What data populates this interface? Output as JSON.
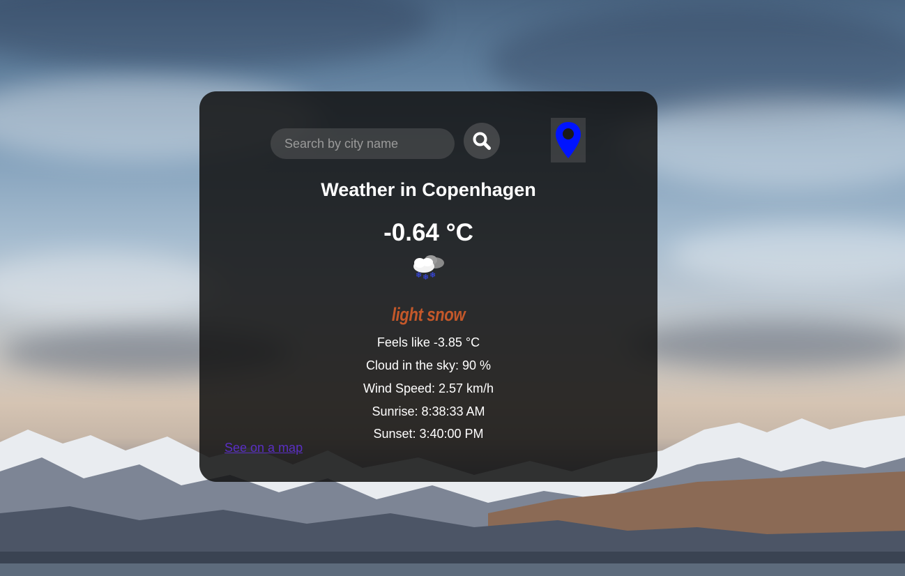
{
  "search": {
    "placeholder": "Search by city name",
    "value": ""
  },
  "icons": {
    "search": "search-icon",
    "location": "location-pin-icon",
    "weather": "snow-cloud-icon"
  },
  "weather": {
    "title": "Weather in Copenhagen",
    "temperature": "-0.64 °C",
    "description": "light snow",
    "feels_like": "Feels like -3.85 °C",
    "clouds": "Cloud in the sky: 90 %",
    "wind": "Wind Speed: 2.57 km/h",
    "sunrise": "Sunrise: 8:38:33 AM",
    "sunset": "Sunset: 3:40:00 PM"
  },
  "links": {
    "map": "See on a map"
  },
  "colors": {
    "card_background": "#121212",
    "description": "#c4582a",
    "location_pin": "#0014ff",
    "link": "#5a2fc4"
  }
}
